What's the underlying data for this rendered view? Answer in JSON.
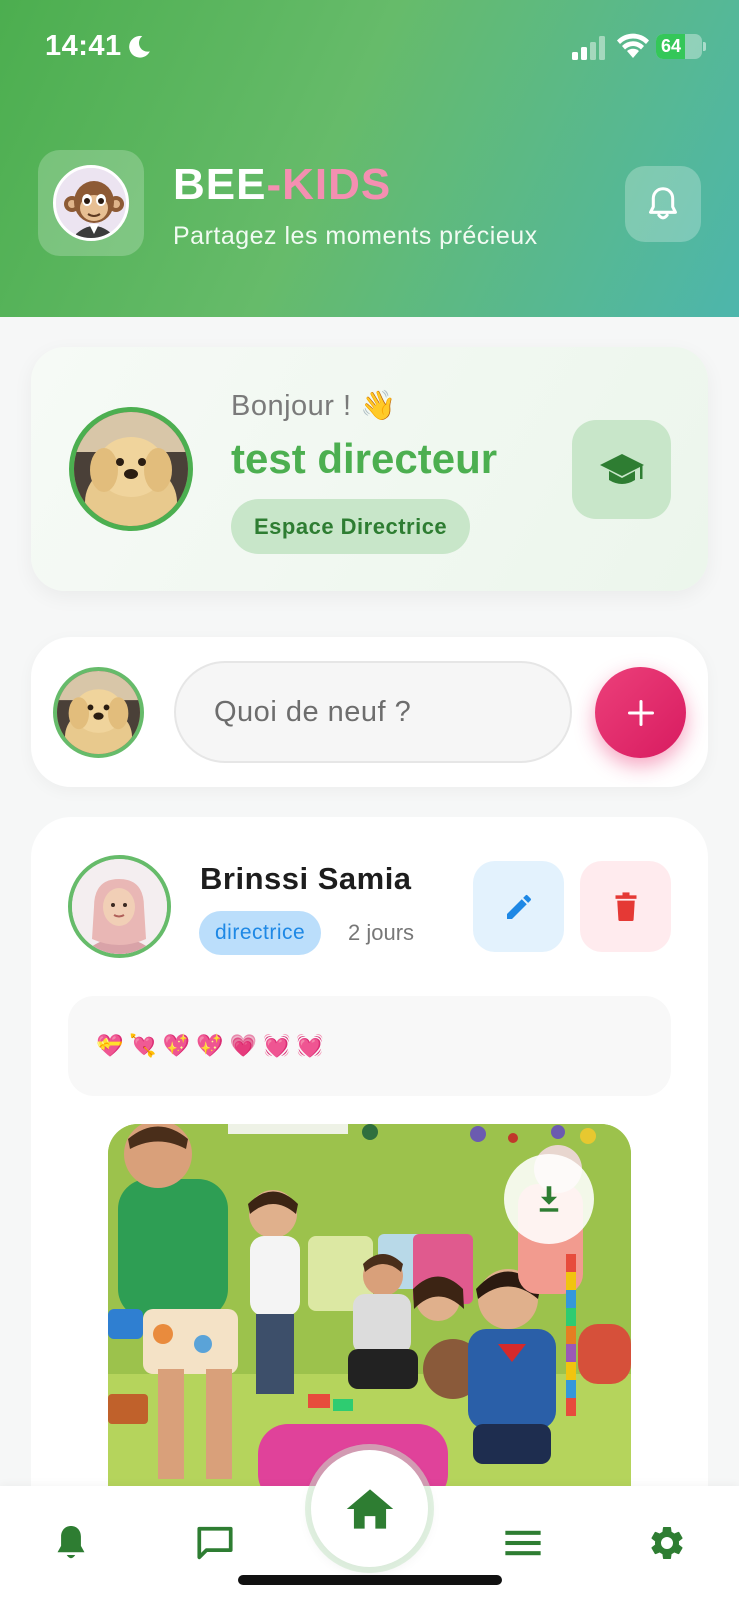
{
  "status_bar": {
    "time": "14:41",
    "battery": "64",
    "battery_level": 0.64,
    "icons": [
      "moon-icon",
      "signal-icon",
      "wifi-icon",
      "battery-icon"
    ]
  },
  "header": {
    "brand_part1": "BEE",
    "brand_part2": "-KIDS",
    "tagline": "Partagez les moments précieux",
    "logo_icon": "monkey-logo-icon",
    "notification_icon": "bell-icon"
  },
  "welcome": {
    "greeting": "Bonjour ! 👋",
    "name": "test directeur",
    "space": "Espace Directrice",
    "action_icon": "graduation-cap-icon"
  },
  "composer": {
    "placeholder": "Quoi de neuf ?",
    "add_icon": "plus-icon"
  },
  "post": {
    "author": "Brinssi Samia",
    "role": "directrice",
    "time": "2 jours",
    "text": "💝💘💖💖💗💓💓",
    "edit_icon": "pencil-icon",
    "delete_icon": "trash-icon",
    "download_icon": "download-icon"
  },
  "nav": {
    "items": [
      "bell-icon",
      "chat-icon",
      "home-icon",
      "menu-icon",
      "gear-icon"
    ]
  },
  "colors": {
    "primary_green": "#4caf50",
    "dark_green": "#2e7d32",
    "pink": "#e91e63",
    "blue": "#1e88e5",
    "red": "#e53935"
  }
}
